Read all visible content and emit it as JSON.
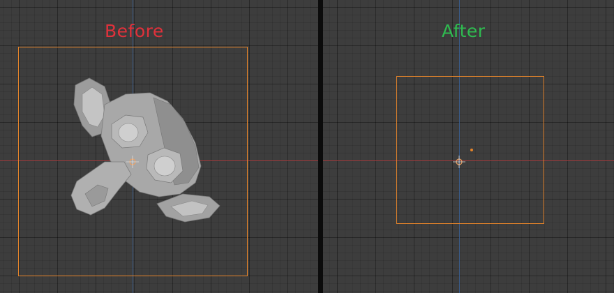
{
  "panels": {
    "before": {
      "label": "Before"
    },
    "after": {
      "label": "After"
    }
  },
  "colors": {
    "before_label": "#e0313b",
    "after_label": "#2fbb50",
    "bounding_box": "#e5842a",
    "x_axis": "#a33a3c",
    "y_axis": "#3a5f93",
    "viewport_background": "#3d3d3d",
    "mesh": "#a6a6a6"
  },
  "objects": [
    {
      "name": "monkey-mesh",
      "icon": "suzanne-monkey-head"
    },
    {
      "name": "origin-cursor",
      "icon": "3d-cursor-icon"
    }
  ]
}
